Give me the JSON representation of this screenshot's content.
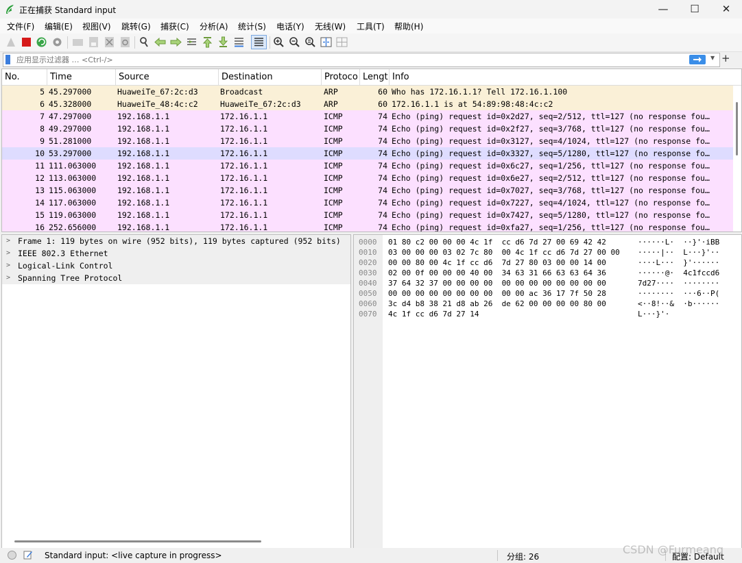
{
  "window": {
    "title": "正在捕获 Standard input",
    "minimize": "—",
    "maximize": "☐",
    "close": "✕"
  },
  "menu": [
    "文件(F)",
    "编辑(E)",
    "视图(V)",
    "跳转(G)",
    "捕获(C)",
    "分析(A)",
    "统计(S)",
    "电话(Y)",
    "无线(W)",
    "工具(T)",
    "帮助(H)"
  ],
  "filter": {
    "placeholder": "应用显示过滤器 … <Ctrl-/>",
    "apply_icon": "arrow-right-icon",
    "add_label": "+"
  },
  "packet_list": {
    "columns": [
      "No.",
      "Time",
      "Source",
      "Destination",
      "Protoco",
      "Lengt",
      "Info"
    ],
    "rows": [
      {
        "no": "5",
        "time": "45.297000",
        "src": "HuaweiTe_67:2c:d3",
        "dst": "Broadcast",
        "proto": "ARP",
        "len": "60",
        "info": "Who has 172.16.1.1? Tell 172.16.1.100"
      },
      {
        "no": "6",
        "time": "45.328000",
        "src": "HuaweiTe_48:4c:c2",
        "dst": "HuaweiTe_67:2c:d3",
        "proto": "ARP",
        "len": "60",
        "info": "172.16.1.1 is at 54:89:98:48:4c:c2"
      },
      {
        "no": "7",
        "time": "47.297000",
        "src": "192.168.1.1",
        "dst": "172.16.1.1",
        "proto": "ICMP",
        "len": "74",
        "info": "Echo (ping) request  id=0x2d27, seq=2/512, ttl=127 (no response fou…"
      },
      {
        "no": "8",
        "time": "49.297000",
        "src": "192.168.1.1",
        "dst": "172.16.1.1",
        "proto": "ICMP",
        "len": "74",
        "info": "Echo (ping) request  id=0x2f27, seq=3/768, ttl=127 (no response fou…"
      },
      {
        "no": "9",
        "time": "51.281000",
        "src": "192.168.1.1",
        "dst": "172.16.1.1",
        "proto": "ICMP",
        "len": "74",
        "info": "Echo (ping) request  id=0x3127, seq=4/1024, ttl=127 (no response fo…"
      },
      {
        "no": "10",
        "time": "53.297000",
        "src": "192.168.1.1",
        "dst": "172.16.1.1",
        "proto": "ICMP",
        "len": "74",
        "info": "Echo (ping) request  id=0x3327, seq=5/1280, ttl=127 (no response fo…"
      },
      {
        "no": "11",
        "time": "111.063000",
        "src": "192.168.1.1",
        "dst": "172.16.1.1",
        "proto": "ICMP",
        "len": "74",
        "info": "Echo (ping) request  id=0x6c27, seq=1/256, ttl=127 (no response fou…"
      },
      {
        "no": "12",
        "time": "113.063000",
        "src": "192.168.1.1",
        "dst": "172.16.1.1",
        "proto": "ICMP",
        "len": "74",
        "info": "Echo (ping) request  id=0x6e27, seq=2/512, ttl=127 (no response fou…"
      },
      {
        "no": "13",
        "time": "115.063000",
        "src": "192.168.1.1",
        "dst": "172.16.1.1",
        "proto": "ICMP",
        "len": "74",
        "info": "Echo (ping) request  id=0x7027, seq=3/768, ttl=127 (no response fou…"
      },
      {
        "no": "14",
        "time": "117.063000",
        "src": "192.168.1.1",
        "dst": "172.16.1.1",
        "proto": "ICMP",
        "len": "74",
        "info": "Echo (ping) request  id=0x7227, seq=4/1024, ttl=127 (no response fo…"
      },
      {
        "no": "15",
        "time": "119.063000",
        "src": "192.168.1.1",
        "dst": "172.16.1.1",
        "proto": "ICMP",
        "len": "74",
        "info": "Echo (ping) request  id=0x7427, seq=5/1280, ttl=127 (no response fo…"
      },
      {
        "no": "16",
        "time": "252.656000",
        "src": "192.168.1.1",
        "dst": "172.16.1.1",
        "proto": "ICMP",
        "len": "74",
        "info": "Echo (ping) request  id=0xfa27, seq=1/256, ttl=127 (no response fou…"
      }
    ]
  },
  "details": [
    "Frame 1: 119 bytes on wire (952 bits), 119 bytes captured (952 bits)",
    "IEEE 802.3 Ethernet",
    "Logical-Link Control",
    "Spanning Tree Protocol"
  ],
  "bytes": [
    {
      "offset": "0000",
      "hex": "01 80 c2 00 00 00 4c 1f  cc d6 7d 27 00 69 42 42",
      "ascii": "······L·  ··}'·iBB"
    },
    {
      "offset": "0010",
      "hex": "03 00 00 00 03 02 7c 80  00 4c 1f cc d6 7d 27 00 00",
      "ascii": "·····|··  L···}'··"
    },
    {
      "offset": "0020",
      "hex": "00 00 80 00 4c 1f cc d6  7d 27 80 03 00 00 14 00",
      "ascii": "····L···  }'······"
    },
    {
      "offset": "0030",
      "hex": "02 00 0f 00 00 00 40 00  34 63 31 66 63 63 64 36",
      "ascii": "······@·  4c1fccd6"
    },
    {
      "offset": "0040",
      "hex": "37 64 32 37 00 00 00 00  00 00 00 00 00 00 00 00",
      "ascii": "7d27····  ········"
    },
    {
      "offset": "0050",
      "hex": "00 00 00 00 00 00 00 00  00 00 ac 36 17 7f 50 28",
      "ascii": "········  ···6··P("
    },
    {
      "offset": "0060",
      "hex": "3c d4 b8 38 21 d8 ab 26  de 62 00 00 00 00 80 00",
      "ascii": "<··8!··&  ·b······"
    },
    {
      "offset": "0070",
      "hex": "4c 1f cc d6 7d 27 14",
      "ascii": "L···}'·"
    }
  ],
  "status": {
    "text": "Standard input: <live capture in progress>",
    "packets": "分组: 26",
    "profile": "配置: Default"
  },
  "watermark": "CSDN @Furmeang",
  "colors": {
    "arp_row": "#faf0d7",
    "icmp_row": "#fce0ff",
    "selected_row": "#dedcff",
    "accent": "#3b8ee8"
  }
}
